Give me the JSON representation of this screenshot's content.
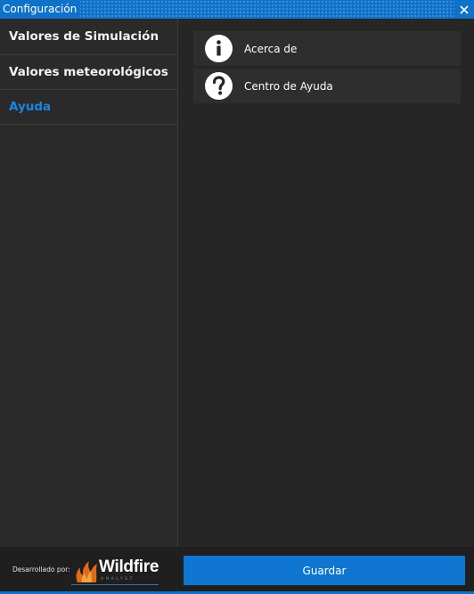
{
  "window": {
    "title": "Configuración",
    "accent": "#0e72c9"
  },
  "sidebar": {
    "items": [
      {
        "label": "Valores de Simulación",
        "active": false
      },
      {
        "label": "Valores meteorológicos",
        "active": false
      },
      {
        "label": "Ayuda",
        "active": true
      }
    ],
    "active_color": "#1a86e0"
  },
  "main": {
    "rows": [
      {
        "label": "Acerca de",
        "icon": "info-icon"
      },
      {
        "label": "Centro de Ayuda",
        "icon": "question-icon"
      }
    ]
  },
  "footer": {
    "developed_by": "Desarrollado por:",
    "logo": {
      "name": "Wildfire",
      "subtitle": "ANALYST"
    },
    "save_label": "Guardar"
  }
}
